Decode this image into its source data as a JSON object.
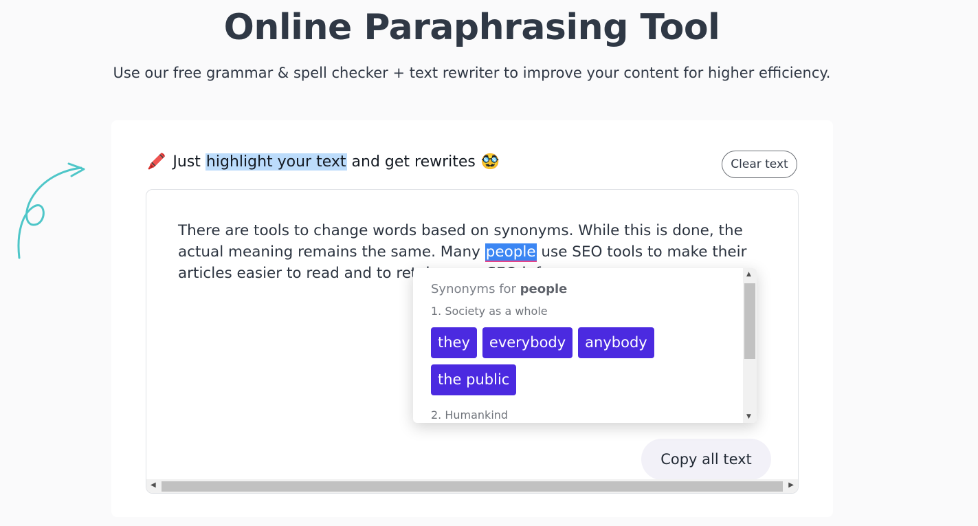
{
  "page": {
    "title": "Online Paraphrasing Tool",
    "subtitle": "Use our free grammar & spell checker + text rewriter to improve your content for higher efficiency."
  },
  "card": {
    "hint_emoji_left": "🖍️",
    "hint_before": "Just ",
    "hint_highlight": "highlight your text",
    "hint_after": " and get rewrites",
    "hint_emoji_right": "🥸",
    "clear_button": "Clear text",
    "copy_button": "Copy all text"
  },
  "editor": {
    "text_before": "There are tools to change words based on synonyms. While this is done, the actual meaning remains the same. Many ",
    "selected_word": "people",
    "text_after": " use SEO tools to make their articles easier to read and to retain more SEO inform"
  },
  "synonyms": {
    "heading_prefix": "Synonyms for ",
    "word": "people",
    "group1_label": "1. Society as a whole",
    "group1_items": [
      "they",
      "everybody",
      "anybody",
      "the public"
    ],
    "group2_label": "2. Humankind"
  },
  "colors": {
    "chip": "#4b2ae0",
    "selection": "#3b86f3",
    "hint_highlight": "#bcdcfb",
    "arrow": "#4ec6c8"
  },
  "icons": {
    "arrow": "curly-arrow-icon",
    "scroll_left": "chevron-left-icon",
    "scroll_right": "chevron-right-icon",
    "scroll_up": "chevron-up-icon",
    "scroll_down": "chevron-down-icon"
  }
}
